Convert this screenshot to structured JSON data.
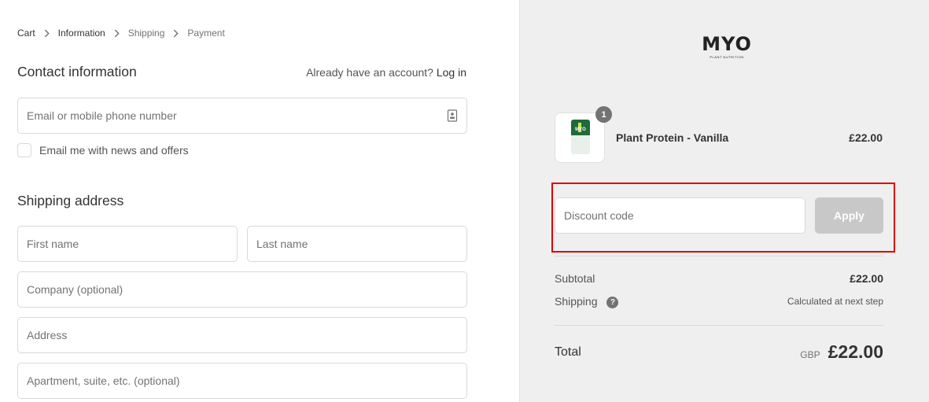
{
  "breadcrumb": {
    "items": [
      "Cart",
      "Information",
      "Shipping",
      "Payment"
    ]
  },
  "contact": {
    "title": "Contact information",
    "login_prompt": "Already have an account?",
    "login_link": "Log in",
    "email_placeholder": "Email or mobile phone number",
    "newsletter_label": "Email me with news and offers"
  },
  "shipping": {
    "title": "Shipping address",
    "first_name_placeholder": "First name",
    "last_name_placeholder": "Last name",
    "company_placeholder": "Company (optional)",
    "address_placeholder": "Address",
    "apartment_placeholder": "Apartment, suite, etc. (optional)"
  },
  "logo": {
    "main": "MYO",
    "sub": "PLANT NUTRITION"
  },
  "cart": {
    "product_name": "Plant Protein - Vanilla",
    "product_price": "£22.00",
    "quantity_badge": "1",
    "jar_label": "MYO"
  },
  "discount": {
    "placeholder": "Discount code",
    "apply_label": "Apply"
  },
  "summary": {
    "subtotal_label": "Subtotal",
    "subtotal_value": "£22.00",
    "shipping_label": "Shipping",
    "shipping_value": "Calculated at next step",
    "help_glyph": "?",
    "total_label": "Total",
    "currency": "GBP",
    "total_value": "£22.00"
  },
  "colors": {
    "highlight": "#e00000",
    "apply_button": "#c8c8c8",
    "sidebar_bg": "#efefef"
  },
  "icons": [
    "chevron-right-icon",
    "contact-card-icon",
    "help-icon"
  ]
}
